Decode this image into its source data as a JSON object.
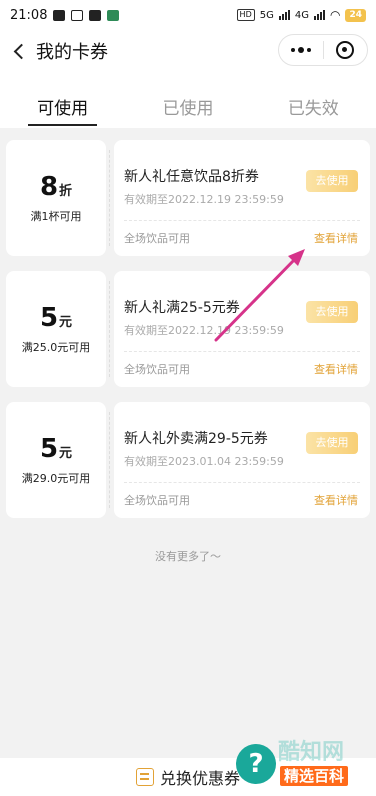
{
  "status_bar": {
    "time": "21:08",
    "net_tag": "HD",
    "net1": "5G",
    "net2": "4G",
    "battery": "24"
  },
  "nav": {
    "title": "我的卡券"
  },
  "tabs": [
    {
      "label": "可使用"
    },
    {
      "label": "已使用"
    },
    {
      "label": "已失效"
    }
  ],
  "coupons": [
    {
      "amount": "8",
      "unit": "折",
      "condition": "满1杯可用",
      "name": "新人礼任意饮品8折券",
      "validity": "有效期至2022.12.19 23:59:59",
      "use_label": "去使用",
      "scope": "全场饮品可用",
      "detail_label": "查看详情"
    },
    {
      "amount": "5",
      "unit": "元",
      "condition": "满25.0元可用",
      "name": "新人礼满25-5元券",
      "validity": "有效期至2022.12.19 23:59:59",
      "use_label": "去使用",
      "scope": "全场饮品可用",
      "detail_label": "查看详情"
    },
    {
      "amount": "5",
      "unit": "元",
      "condition": "满29.0元可用",
      "name": "新人礼外卖满29-5元券",
      "validity": "有效期至2023.01.04 23:59:59",
      "use_label": "去使用",
      "scope": "全场饮品可用",
      "detail_label": "查看详情"
    }
  ],
  "footer_note": "没有更多了～",
  "bottom": {
    "exchange_label": "兑换优惠券"
  },
  "watermark": {
    "top_text": "酷知网",
    "bottom_text": "精选百科"
  },
  "colors": {
    "accent": "#e2a236",
    "annotation_arrow": "#d6338a"
  }
}
